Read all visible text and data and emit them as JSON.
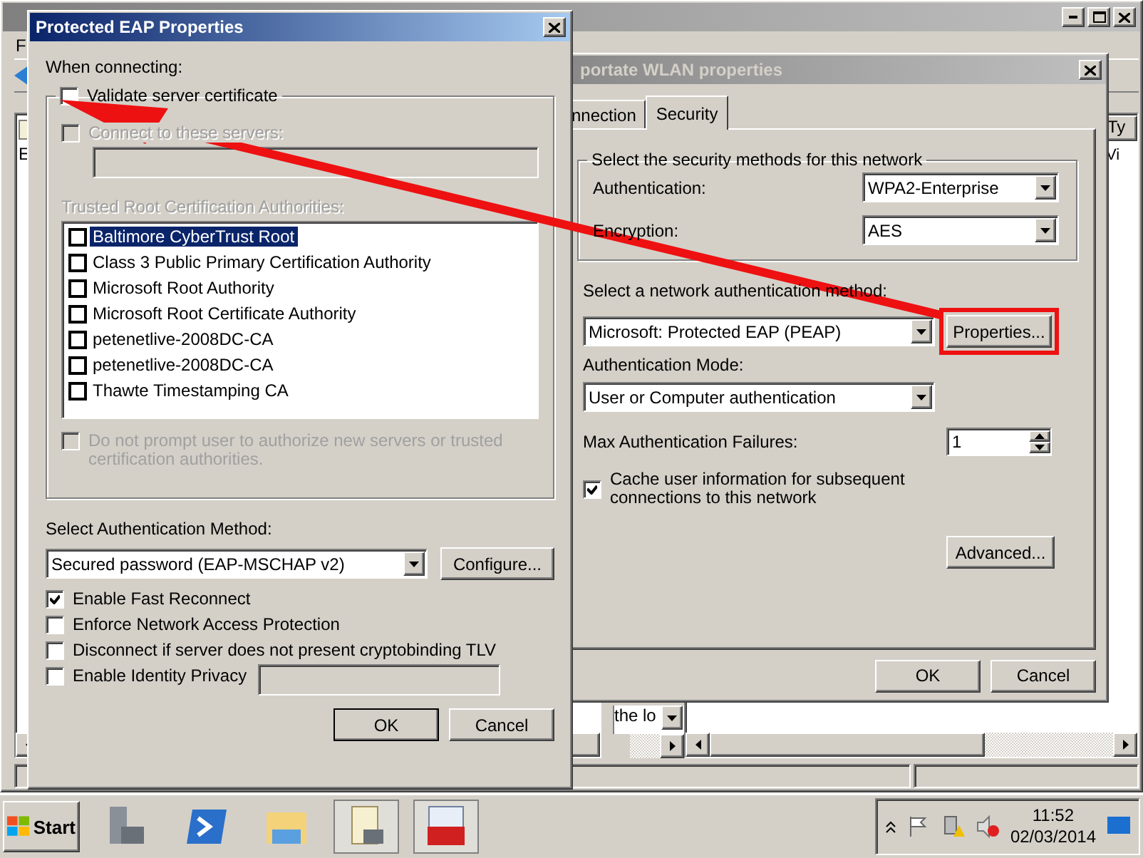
{
  "main_window": {
    "menu_fragment": "F",
    "tree_fragment": "E",
    "column_fragment": "Ty",
    "cell_fragment": "Vi",
    "field_fragment": "the lo"
  },
  "wlan_dialog": {
    "title": "portate WLAN properties",
    "active": false,
    "tabs": [
      {
        "label": "nnection",
        "selected": false
      },
      {
        "label": "Security",
        "selected": true
      }
    ],
    "group_title": "Select the security methods for this network",
    "authentication_label": "Authentication:",
    "authentication_value": "WPA2-Enterprise",
    "encryption_label": "Encryption:",
    "encryption_value": "AES",
    "method_label": "Select a network authentication method:",
    "method_value": "Microsoft: Protected EAP (PEAP)",
    "properties_button": "Properties...",
    "mode_label": "Authentication Mode:",
    "mode_value": "User or Computer authentication",
    "max_failures_label": "Max Authentication Failures:",
    "max_failures_value": "1",
    "cache": {
      "label": "Cache user information for subsequent connections to this network",
      "checked": true
    },
    "advanced_button": "Advanced...",
    "buttons": [
      "OK",
      "Cancel"
    ]
  },
  "peap_dialog": {
    "title": "Protected EAP Properties",
    "active": true,
    "when_connecting": "When connecting:",
    "validate": {
      "label": "Validate server certificate",
      "checked": false
    },
    "connect_servers": {
      "label": "Connect to these servers:",
      "checked": false,
      "disabled": true
    },
    "trusted_label": "Trusted Root Certification Authorities:",
    "authorities": [
      {
        "label": "Baltimore CyberTrust Root",
        "checked": false,
        "selected": true
      },
      {
        "label": "Class 3 Public Primary Certification Authority",
        "checked": false,
        "selected": false
      },
      {
        "label": "Microsoft Root Authority",
        "checked": false,
        "selected": false
      },
      {
        "label": "Microsoft Root Certificate Authority",
        "checked": false,
        "selected": false
      },
      {
        "label": "petenetlive-2008DC-CA",
        "checked": false,
        "selected": false
      },
      {
        "label": "petenetlive-2008DC-CA",
        "checked": false,
        "selected": false
      },
      {
        "label": "Thawte Timestamping CA",
        "checked": false,
        "selected": false
      }
    ],
    "no_prompt": {
      "label": "Do not prompt user to authorize new servers or trusted certification authorities.",
      "checked": false,
      "disabled": true
    },
    "method_label": "Select Authentication Method:",
    "method_value": "Secured password (EAP-MSCHAP v2)",
    "configure_button": "Configure...",
    "options": [
      {
        "label": "Enable Fast Reconnect",
        "checked": true
      },
      {
        "label": "Enforce Network Access Protection",
        "checked": false
      },
      {
        "label": "Disconnect if server does not present cryptobinding TLV",
        "checked": false
      },
      {
        "label": "Enable Identity Privacy",
        "checked": false
      }
    ],
    "buttons": [
      "OK",
      "Cancel"
    ]
  },
  "taskbar": {
    "start": "Start",
    "time": "11:52",
    "date": "02/03/2014"
  }
}
